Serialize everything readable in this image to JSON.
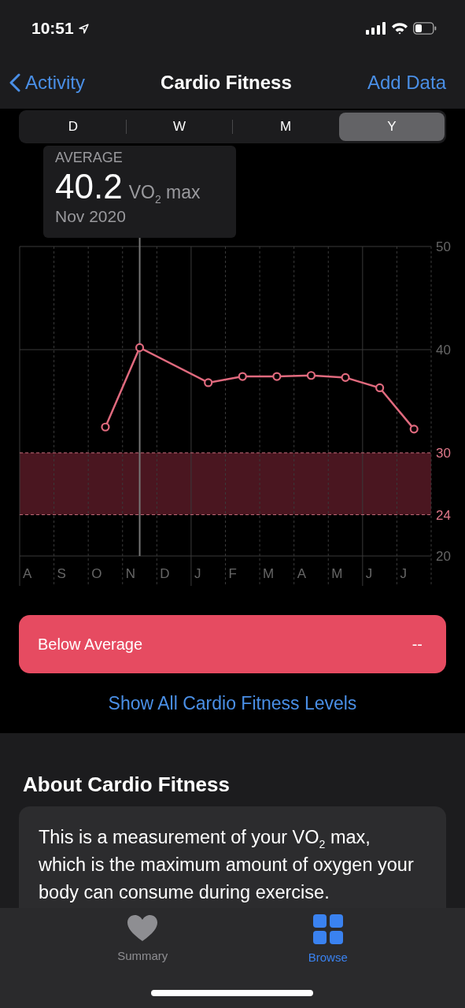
{
  "status_bar": {
    "time": "10:51"
  },
  "nav": {
    "back": "Activity",
    "title": "Cardio Fitness",
    "action": "Add Data"
  },
  "segments": [
    {
      "label": "D",
      "selected": false
    },
    {
      "label": "W",
      "selected": false
    },
    {
      "label": "M",
      "selected": false
    },
    {
      "label": "Y",
      "selected": true
    }
  ],
  "tooltip": {
    "label": "AVERAGE",
    "value": "40.2",
    "unit": "VO$_{2}$ max",
    "date": "Nov 2020"
  },
  "chart_data": {
    "type": "line",
    "categories": [
      "A",
      "S",
      "O",
      "N",
      "D",
      "J",
      "F",
      "M",
      "A",
      "M",
      "J",
      "J"
    ],
    "series": [
      {
        "color": "#e06a7e",
        "marker": true,
        "values": [
          null,
          null,
          32.5,
          40.2,
          null,
          36.8,
          37.4,
          37.4,
          37.5,
          37.3,
          36.3,
          32.3
        ]
      }
    ],
    "ylim": [
      20,
      50
    ],
    "yticks": [
      20,
      24,
      30,
      40,
      50
    ],
    "bands": [
      {
        "axis": "y",
        "from": 24,
        "to": 30
      }
    ],
    "ref_lines": [
      {
        "axis": "x",
        "value": "N",
        "color": "#777777"
      }
    ]
  },
  "level_row": {
    "label": "Below Average",
    "value": "--"
  },
  "levels_link": "Show All Cardio Fitness Levels",
  "about": {
    "heading": "About Cardio Fitness",
    "text": "This is a measurement of your VO$_{2}$ max, which is the maximum amount of oxygen your body can consume during exercise."
  },
  "tab_bar": [
    {
      "label": "Summary",
      "kind": "heart",
      "selected": false
    },
    {
      "label": "Browse",
      "kind": "grid",
      "selected": true
    }
  ]
}
